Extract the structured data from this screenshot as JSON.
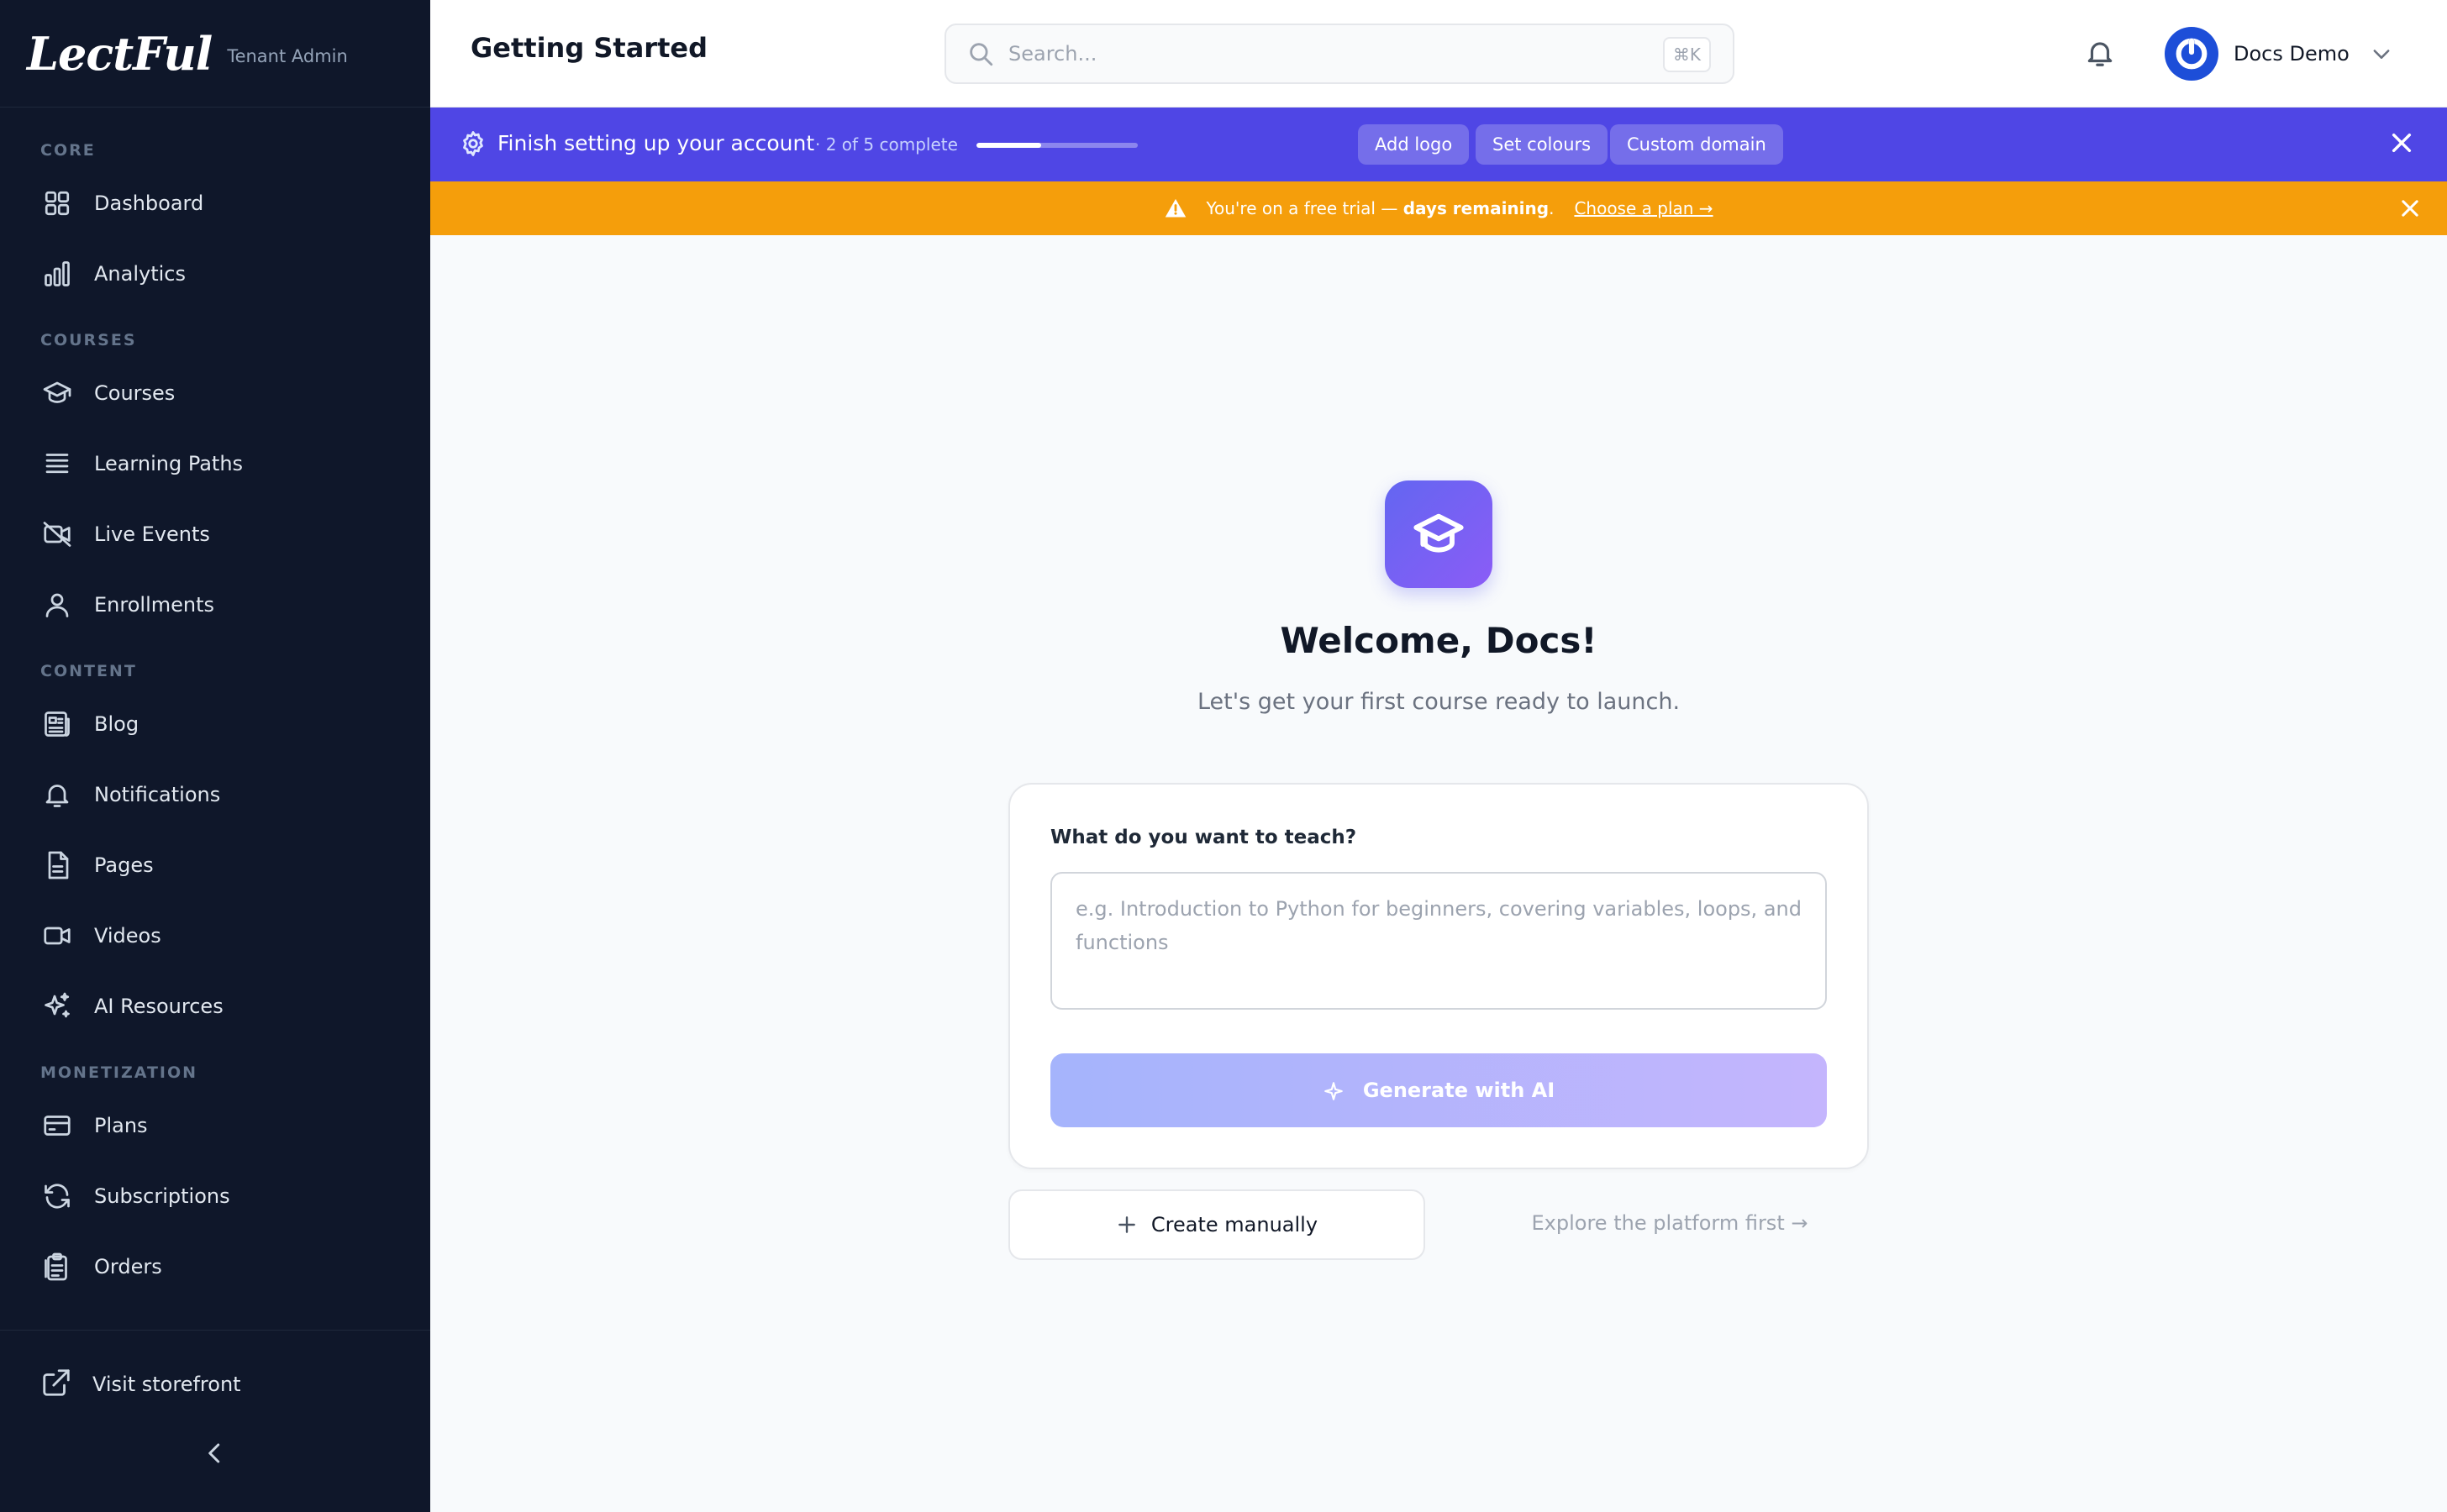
{
  "brand": {
    "logo_text": "LectFul",
    "subtitle": "Tenant Admin"
  },
  "sidebar": {
    "sections": [
      {
        "title": "CORE",
        "items": [
          {
            "label": "Dashboard",
            "icon": "grid-icon"
          },
          {
            "label": "Analytics",
            "icon": "bar-chart-icon"
          }
        ]
      },
      {
        "title": "COURSES",
        "items": [
          {
            "label": "Courses",
            "icon": "graduation-cap-icon"
          },
          {
            "label": "Learning Paths",
            "icon": "layers-icon"
          },
          {
            "label": "Live Events",
            "icon": "video-off-icon"
          },
          {
            "label": "Enrollments",
            "icon": "user-icon"
          }
        ]
      },
      {
        "title": "CONTENT",
        "items": [
          {
            "label": "Blog",
            "icon": "newspaper-icon"
          },
          {
            "label": "Notifications",
            "icon": "bell-icon"
          },
          {
            "label": "Pages",
            "icon": "file-icon"
          },
          {
            "label": "Videos",
            "icon": "video-icon"
          },
          {
            "label": "AI Resources",
            "icon": "sparkles-icon"
          }
        ]
      },
      {
        "title": "MONETIZATION",
        "items": [
          {
            "label": "Plans",
            "icon": "credit-card-icon"
          },
          {
            "label": "Subscriptions",
            "icon": "refresh-icon"
          },
          {
            "label": "Orders",
            "icon": "clipboard-icon"
          }
        ]
      }
    ],
    "storefront_label": "Visit storefront"
  },
  "header": {
    "title": "Getting Started",
    "search_placeholder": "Search...",
    "search_shortcut": "⌘K",
    "user_name": "Docs Demo"
  },
  "setup_banner": {
    "title": "Finish setting up your account",
    "count": "· 2 of 5 complete",
    "progress": 0.4,
    "chips": [
      "Add logo",
      "Set colours",
      "Custom domain"
    ]
  },
  "trial_banner": {
    "message_prefix": "You're on a free trial — ",
    "message_bold": "days remaining",
    "message_suffix": ".",
    "cta": "Choose a plan →"
  },
  "main": {
    "welcome": "Welcome, Docs!",
    "tagline": "Let's get your first course ready to launch.",
    "question": "What do you want to teach?",
    "textarea_placeholder": "e.g. Introduction to Python for beginners, covering variables, loops, and functions",
    "generate_label": "Generate with AI",
    "manual_label": "Create manually",
    "explore_label": "Explore the platform first →"
  },
  "colors": {
    "sidebar_bg": "#0f172a",
    "accent": "#4f46e5",
    "trial_bg": "#f59e0b",
    "avatar": "#1d4ed8"
  }
}
